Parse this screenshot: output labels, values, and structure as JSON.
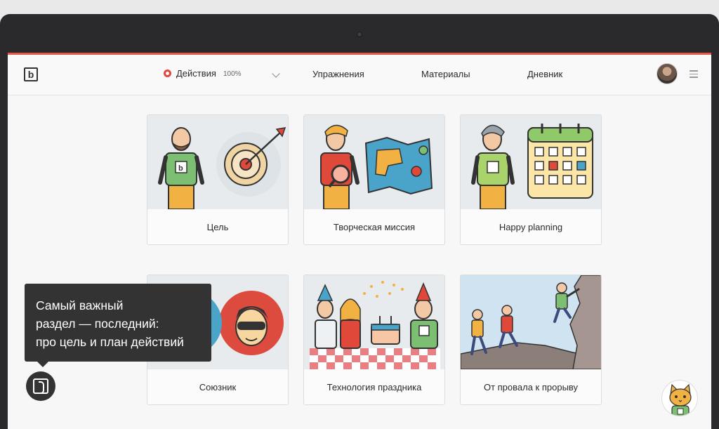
{
  "header": {
    "logo": "b",
    "nav": {
      "actions_label": "Действия",
      "actions_progress": "100%",
      "exercises": "Упражнения",
      "materials": "Материалы",
      "diary": "Дневник"
    }
  },
  "cards": [
    {
      "title": "Цель",
      "icon": "goal-illustration"
    },
    {
      "title": "Творческая миссия",
      "icon": "mission-map-illustration"
    },
    {
      "title": "Happy planning",
      "icon": "calendar-illustration"
    },
    {
      "title": "Союзник",
      "icon": "ally-illustration"
    },
    {
      "title": "Технология праздника",
      "icon": "celebration-illustration"
    },
    {
      "title": "От провала к прорыву",
      "icon": "climbing-illustration"
    }
  ],
  "tooltip": {
    "line1": "Самый важный",
    "line2": "раздел — последний:",
    "line3": "про цель и план действий"
  },
  "colors": {
    "accent": "#e05a47",
    "dark": "#333333",
    "card_art_bg": "#e7ebed"
  }
}
